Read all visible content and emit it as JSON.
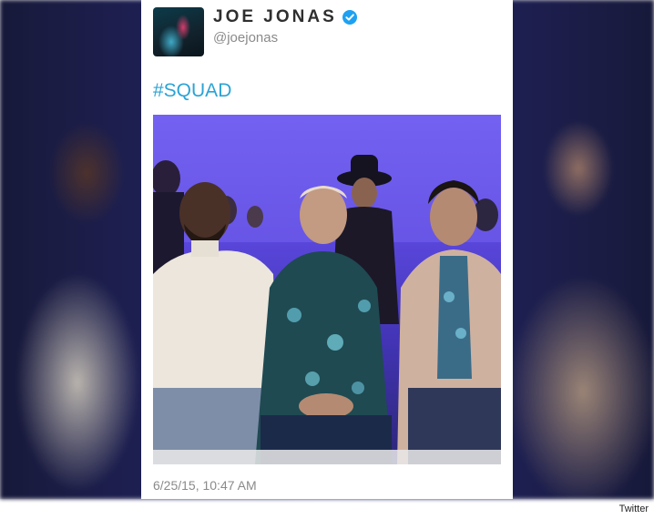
{
  "tweet": {
    "display_name": "JOE JONAS",
    "handle": "@joejonas",
    "verified": true,
    "text": "#SQUAD",
    "timestamp": "6/25/15, 10:47 AM",
    "photo_alt_icon": "tweet-photo"
  },
  "credit": "Twitter",
  "colors": {
    "hashtag": "#2ba3d5",
    "verified_badge": "#1da1f2",
    "name": "#2f2f2f",
    "meta": "#8a8a8a"
  }
}
